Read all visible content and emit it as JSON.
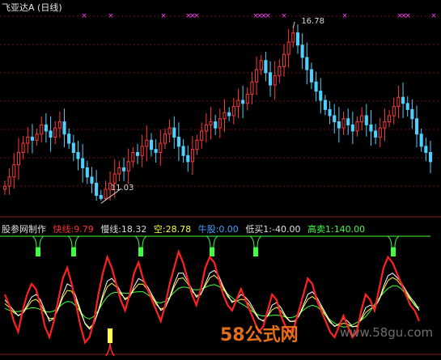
{
  "title": "飞亚达A (日线)",
  "annotations": {
    "high_label": "16.78",
    "low_label": "11.03"
  },
  "indicator": {
    "name": "股参网制作",
    "fast": "快线:9.79",
    "slow": "慢线:18.32",
    "empty": "空:28.78",
    "bull": "牛股:0.00",
    "low_buy": "低买1:-40.00",
    "high_sell": "高卖1:140.00"
  },
  "watermark": {
    "main": "58公式网",
    "url": "www.58gu.com"
  },
  "colors": {
    "up": "#ff3a3a",
    "down": "#4fd0ff",
    "fast": "#ff2020",
    "slow_a": "#ffffff",
    "slow_b": "#ffff40",
    "slow_c": "#40ff40",
    "signal": "#40ff40",
    "marker": "#ff40ff"
  },
  "chart_data": [
    {
      "type": "candlestick",
      "title": "飞亚达A (日线)",
      "y_range": [
        11.03,
        16.78
      ],
      "close": [
        11.5,
        11.8,
        12.2,
        12.6,
        12.9,
        13.1,
        13.0,
        13.2,
        13.5,
        13.3,
        13.1,
        13.4,
        13.6,
        13.2,
        12.9,
        12.6,
        12.4,
        12.1,
        11.8,
        11.6,
        11.2,
        11.1,
        11.4,
        11.6,
        11.9,
        12.1,
        12.0,
        12.3,
        12.6,
        12.5,
        12.8,
        13.0,
        12.7,
        12.6,
        12.9,
        13.2,
        13.4,
        13.1,
        12.8,
        12.5,
        12.3,
        12.7,
        13.0,
        13.3,
        13.5,
        13.6,
        13.4,
        13.7,
        13.9,
        13.8,
        14.1,
        14.3,
        14.2,
        14.5,
        14.9,
        15.3,
        15.6,
        15.2,
        14.8,
        15.1,
        15.4,
        15.8,
        16.2,
        16.5,
        16.1,
        15.7,
        15.3,
        14.9,
        14.6,
        14.3,
        14.0,
        13.8,
        13.6,
        13.4,
        13.7,
        13.5,
        13.3,
        13.6,
        13.8,
        13.5,
        13.3,
        13.1,
        13.4,
        13.6,
        13.8,
        14.1,
        14.4,
        14.2,
        14.0,
        13.7,
        13.2,
        12.8,
        12.6,
        12.3
      ]
    },
    {
      "type": "line",
      "series": [
        {
          "name": "快线",
          "last": 9.79
        },
        {
          "name": "慢线",
          "last": 18.32
        },
        {
          "name": "空",
          "last": 28.78
        },
        {
          "name": "牛股",
          "last": 0.0
        },
        {
          "name": "低买1",
          "last": -40.0
        },
        {
          "name": "高卖1",
          "last": 140.0
        }
      ],
      "fast": [
        40,
        20,
        -10,
        -30,
        10,
        40,
        60,
        50,
        20,
        -20,
        -40,
        -10,
        30,
        70,
        90,
        60,
        20,
        -20,
        -50,
        -40,
        -10,
        40,
        80,
        110,
        90,
        60,
        30,
        10,
        40,
        80,
        100,
        70,
        50,
        30,
        10,
        -10,
        20,
        60,
        90,
        120,
        100,
        70,
        40,
        20,
        50,
        90,
        110,
        100,
        70,
        40,
        20,
        10,
        30,
        50,
        30,
        10,
        -10,
        -30,
        -20,
        10,
        40,
        30,
        0,
        -20,
        -30,
        -20,
        10,
        40,
        70,
        60,
        30,
        10,
        -10,
        -30,
        -40,
        -20,
        0,
        -20,
        -40,
        -30,
        10,
        40,
        30,
        10,
        50,
        90,
        110,
        100,
        80,
        60,
        40,
        20,
        10,
        -10
      ],
      "slow": [
        30,
        20,
        10,
        0,
        5,
        20,
        35,
        40,
        30,
        10,
        -10,
        -5,
        15,
        40,
        60,
        55,
        35,
        10,
        -15,
        -25,
        -15,
        10,
        40,
        65,
        70,
        60,
        45,
        30,
        35,
        55,
        70,
        65,
        55,
        40,
        25,
        10,
        15,
        35,
        60,
        80,
        80,
        65,
        50,
        35,
        40,
        60,
        80,
        85,
        75,
        55,
        40,
        25,
        30,
        40,
        35,
        25,
        10,
        -5,
        -10,
        0,
        20,
        25,
        15,
        0,
        -10,
        -10,
        0,
        20,
        40,
        45,
        35,
        20,
        5,
        -10,
        -20,
        -15,
        -5,
        -10,
        -20,
        -20,
        -5,
        15,
        20,
        15,
        30,
        55,
        75,
        80,
        72,
        62,
        48,
        35,
        25,
        10
      ]
    }
  ]
}
